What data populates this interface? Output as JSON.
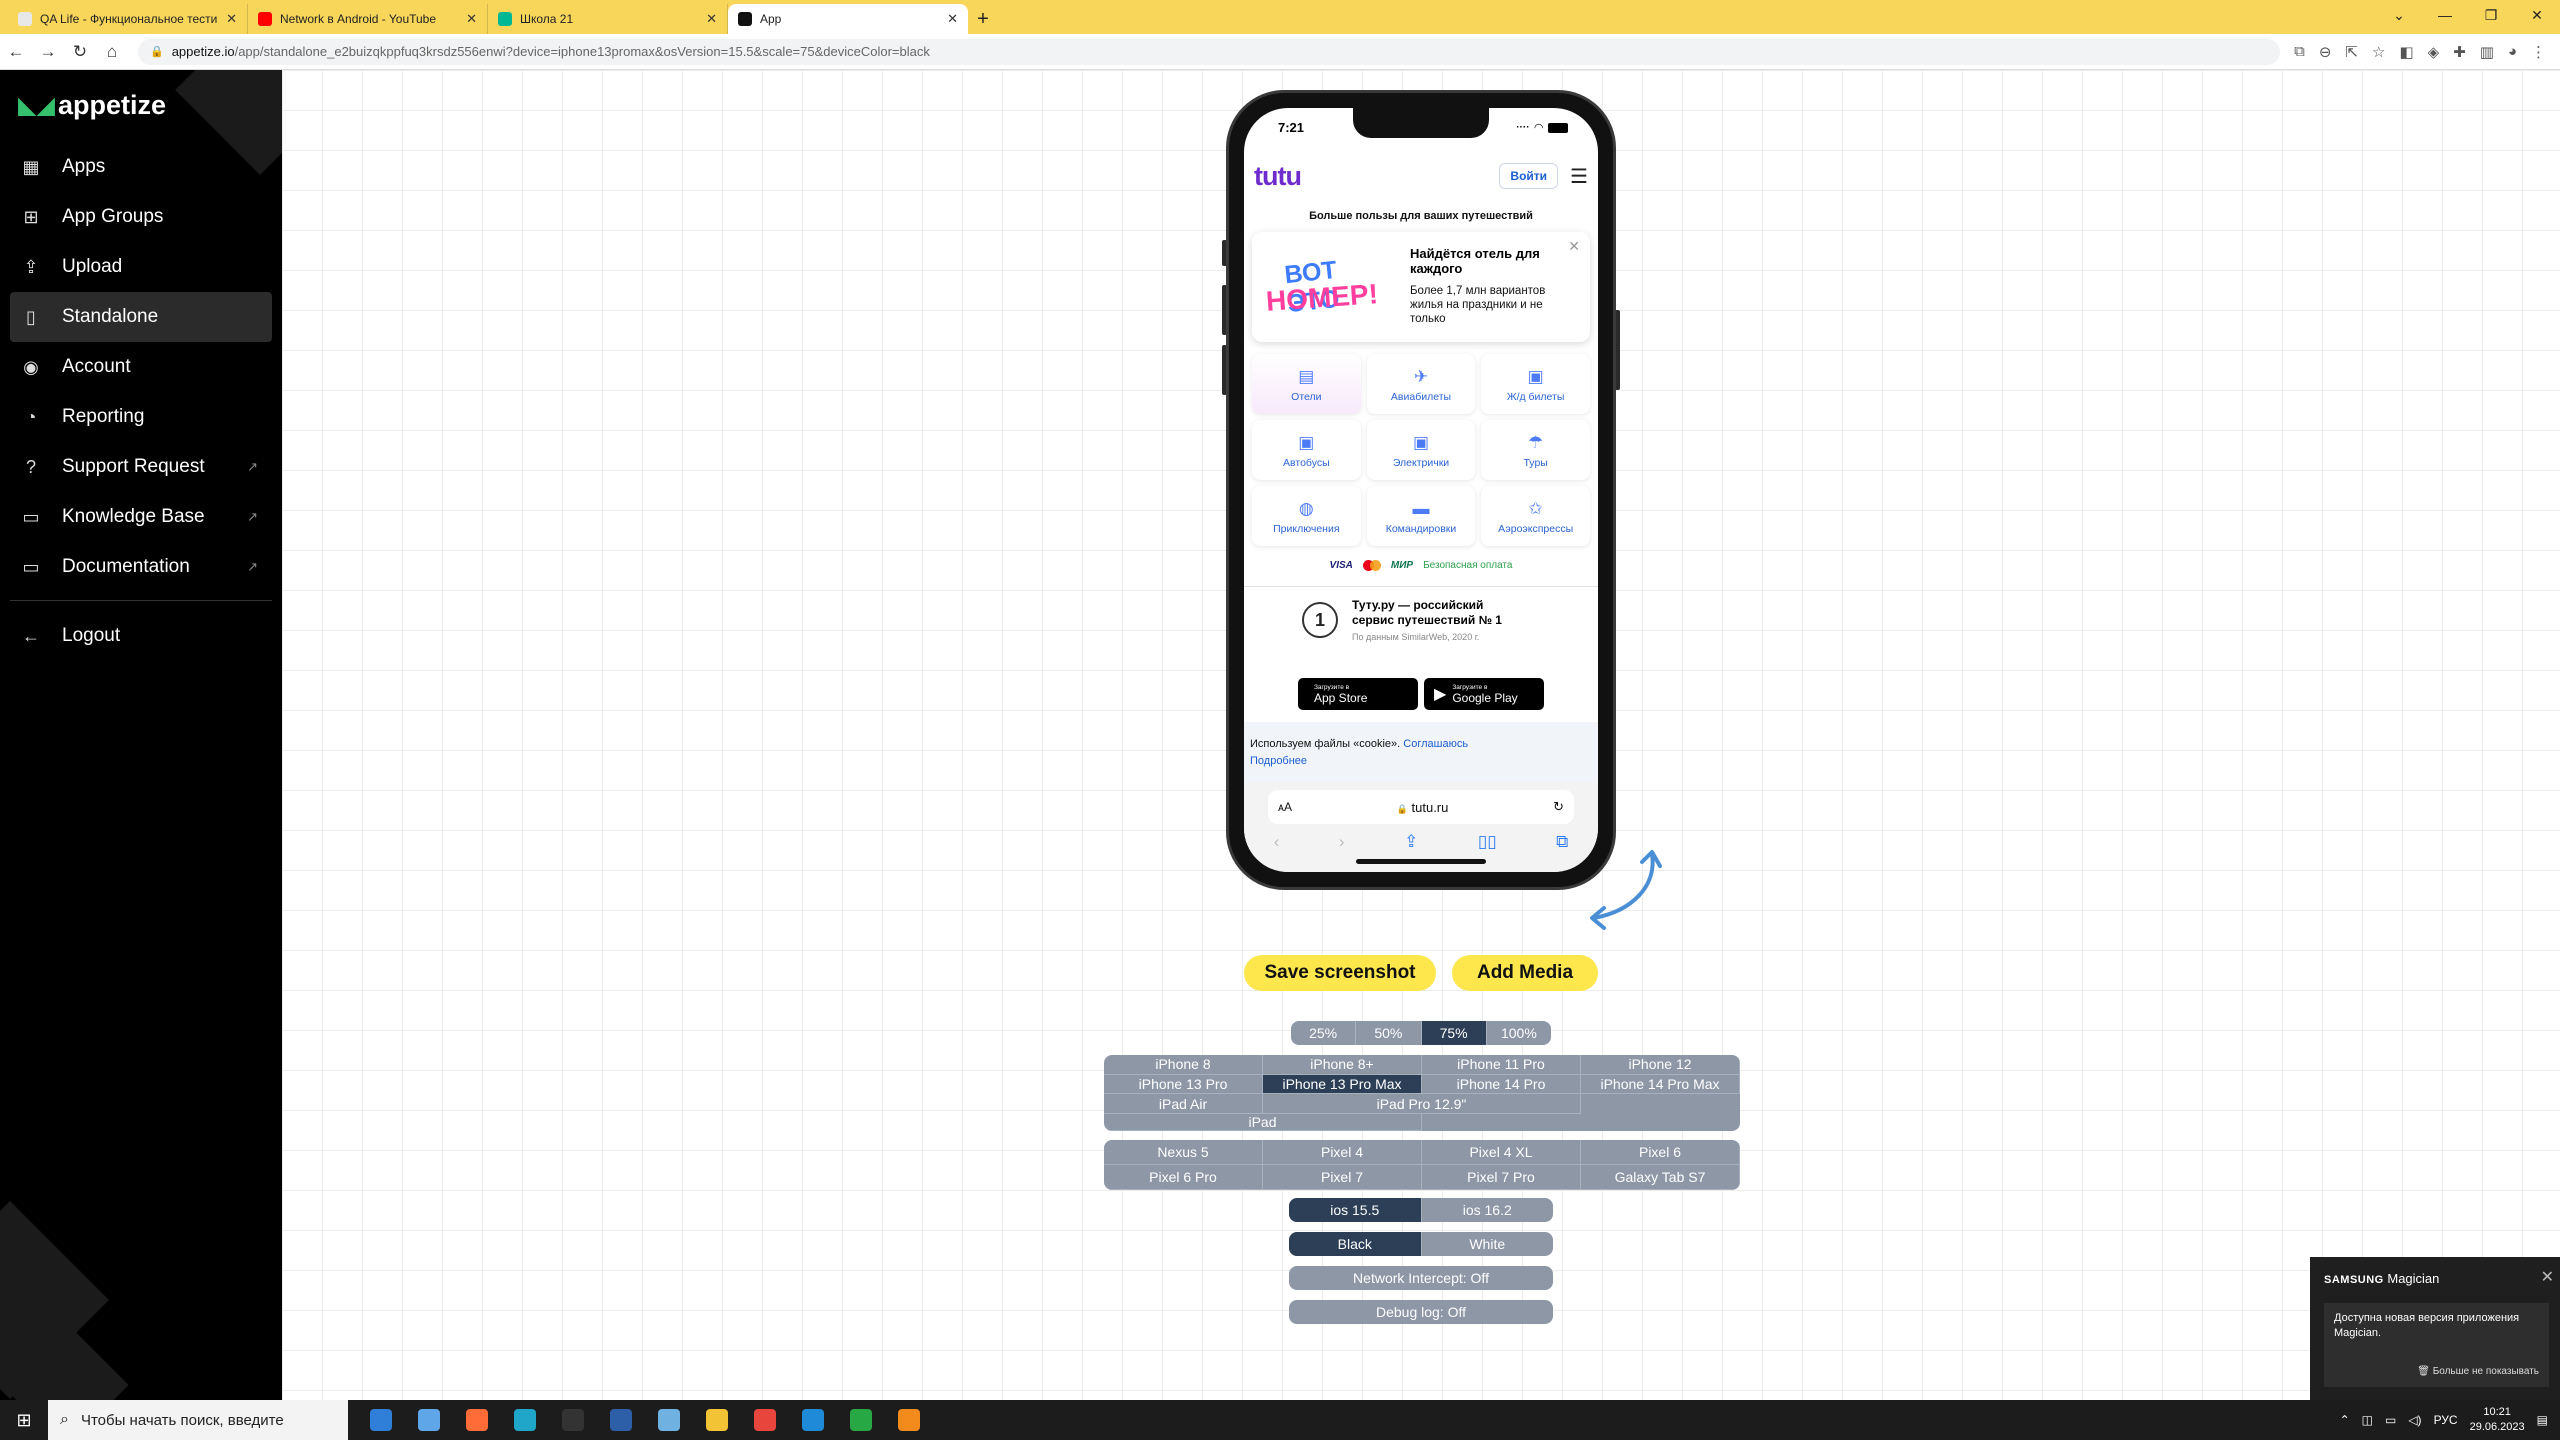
{
  "browser": {
    "tabs": [
      {
        "title": "QA Life - Функциональное тести",
        "fav_color": "#e8e8e8",
        "active": false
      },
      {
        "title": "Network в Android - YouTube",
        "fav_color": "#ff0000",
        "active": false
      },
      {
        "title": "Школа 21",
        "fav_color": "#00b894",
        "active": false
      },
      {
        "title": "App",
        "fav_color": "#111111",
        "active": true
      }
    ],
    "url_host": "appetize.io",
    "url_path": "/app/standalone_e2buizqkppfuq3krsdz556enwi?device=iphone13promax&osVersion=15.5&scale=75&deviceColor=black"
  },
  "sidebar": {
    "brand": "appetize",
    "items": [
      {
        "label": "Apps",
        "icon": "grid-icon",
        "glyph": "▦",
        "active": false,
        "external": false
      },
      {
        "label": "App Groups",
        "icon": "app-groups-icon",
        "glyph": "⊞",
        "active": false,
        "external": false
      },
      {
        "label": "Upload",
        "icon": "upload-icon",
        "glyph": "⇪",
        "active": false,
        "external": false
      },
      {
        "label": "Standalone",
        "icon": "phone-icon",
        "glyph": "▯",
        "active": true,
        "external": false
      },
      {
        "label": "Account",
        "icon": "account-icon",
        "glyph": "◉",
        "active": false,
        "external": false
      },
      {
        "label": "Reporting",
        "icon": "reporting-icon",
        "glyph": "◔",
        "active": false,
        "external": false
      },
      {
        "label": "Support Request",
        "icon": "help-icon",
        "glyph": "?",
        "active": false,
        "external": true
      },
      {
        "label": "Knowledge Base",
        "icon": "book-icon",
        "glyph": "▭",
        "active": false,
        "external": true
      },
      {
        "label": "Documentation",
        "icon": "docs-icon",
        "glyph": "▭",
        "active": false,
        "external": true
      }
    ],
    "logout": "Logout"
  },
  "device": {
    "status_time": "7:21",
    "app": {
      "logo": "tutu",
      "login": "Войти",
      "slogan": "Больше пользы для ваших путешествий",
      "promo_art_line1": "ВОТ ЭТО",
      "promo_art_line2": "НОМЕР!",
      "promo_title": "Найдётся отель для каждого",
      "promo_text": "Более 1,7 млн вариантов жилья на праздники и не только",
      "services": [
        {
          "label": "Отели",
          "glyph": "▤",
          "icon": "hotel-icon",
          "active": true
        },
        {
          "label": "Авиабилеты",
          "glyph": "✈",
          "icon": "plane-icon",
          "active": false
        },
        {
          "label": "Ж/д билеты",
          "glyph": "▣",
          "icon": "train-icon",
          "active": false
        },
        {
          "label": "Автобусы",
          "glyph": "▣",
          "icon": "bus-icon",
          "active": false
        },
        {
          "label": "Электрички",
          "glyph": "▣",
          "icon": "suburban-train-icon",
          "active": false
        },
        {
          "label": "Туры",
          "glyph": "☂",
          "icon": "tours-icon",
          "active": false
        },
        {
          "label": "Приключения",
          "glyph": "◍",
          "icon": "balloon-icon",
          "active": false
        },
        {
          "label": "Командировки",
          "glyph": "▬",
          "icon": "briefcase-icon",
          "active": false
        },
        {
          "label": "Аэроэкспрессы",
          "glyph": "✩",
          "icon": "aeroexpress-icon",
          "active": false
        }
      ],
      "pay_visa": "VISA",
      "pay_mir": "МИР",
      "pay_safe": "Безопасная оплата",
      "award_num": "1",
      "award_title": "Туту.ру — российский сервис путешествий № 1",
      "award_source": "По данным SimilarWeb, 2020 г.",
      "appstore_small": "Загрузите в",
      "appstore_big": "App Store",
      "gplay_small": "Загрузите в",
      "gplay_big": "Google Play",
      "cookie_text": "Используем файлы «cookie».",
      "cookie_agree": "Соглашаюсь",
      "cookie_more": "Подробнее"
    },
    "safari": {
      "aa": "ᴀA",
      "domain": "tutu.ru"
    }
  },
  "actions": {
    "save": "Save screenshot",
    "add_media": "Add Media"
  },
  "scales": [
    {
      "label": "25%",
      "sel": false
    },
    {
      "label": "50%",
      "sel": false
    },
    {
      "label": "75%",
      "sel": true
    },
    {
      "label": "100%",
      "sel": false
    }
  ],
  "ios_devices": [
    {
      "label": "iPhone 8",
      "sel": false,
      "span": 1
    },
    {
      "label": "iPhone 8+",
      "sel": false,
      "span": 1
    },
    {
      "label": "iPhone 11 Pro",
      "sel": false,
      "span": 1
    },
    {
      "label": "iPhone 12",
      "sel": false,
      "span": 1
    },
    {
      "label": "iPhone 13 Pro",
      "sel": false,
      "span": 1
    },
    {
      "label": "iPhone 13 Pro Max",
      "sel": true,
      "span": 1
    },
    {
      "label": "iPhone 14 Pro",
      "sel": false,
      "span": 1
    },
    {
      "label": "iPhone 14 Pro Max",
      "sel": false,
      "span": 1
    },
    {
      "label": "iPad Air",
      "sel": false,
      "span": 1
    },
    {
      "label": "iPad Pro 12.9\"",
      "sel": false,
      "span": 2
    },
    {
      "label": "iPad",
      "sel": false,
      "span": 2
    }
  ],
  "android_devices": [
    {
      "label": "Nexus 5",
      "sel": false
    },
    {
      "label": "Pixel 4",
      "sel": false
    },
    {
      "label": "Pixel 4 XL",
      "sel": false
    },
    {
      "label": "Pixel 6",
      "sel": false
    },
    {
      "label": "Pixel 6 Pro",
      "sel": false
    },
    {
      "label": "Pixel 7",
      "sel": false
    },
    {
      "label": "Pixel 7 Pro",
      "sel": false
    },
    {
      "label": "Galaxy Tab S7",
      "sel": false
    }
  ],
  "os_versions": [
    {
      "label": "ios 15.5",
      "sel": true
    },
    {
      "label": "ios 16.2",
      "sel": false
    }
  ],
  "colors": [
    {
      "label": "Black",
      "sel": true
    },
    {
      "label": "White",
      "sel": false
    }
  ],
  "network_intercept": "Network Intercept: Off",
  "debug_log": "Debug log: Off",
  "toast": {
    "brand": "SAMSUNG",
    "app": "Magician",
    "message": "Доступна новая версия приложения Magician.",
    "dismiss": "Больше не показывать"
  },
  "taskbar": {
    "search_placeholder": "Чтобы начать поиск, введите",
    "apps": [
      {
        "icon": "windows-landscape-icon",
        "color": "#2f7fd8"
      },
      {
        "icon": "explorer-icon",
        "color": "#5fa6e8"
      },
      {
        "icon": "postman-icon",
        "color": "#ff6c37"
      },
      {
        "icon": "edge-icon",
        "color": "#1fa6c9"
      },
      {
        "icon": "terminal-icon",
        "color": "#333333"
      },
      {
        "icon": "powershell-icon",
        "color": "#2d5ea8"
      },
      {
        "icon": "notepad-icon",
        "color": "#6fb1e0"
      },
      {
        "icon": "folder-icon",
        "color": "#f2c335"
      },
      {
        "icon": "chrome-icon",
        "color": "#e8453c"
      },
      {
        "icon": "vscode-icon",
        "color": "#1f8ad8"
      },
      {
        "icon": "xbox-icon",
        "color": "#28a745"
      },
      {
        "icon": "sublime-icon",
        "color": "#f28b1c"
      }
    ],
    "lang": "РУС",
    "time": "10:21",
    "date": "29.06.2023"
  }
}
